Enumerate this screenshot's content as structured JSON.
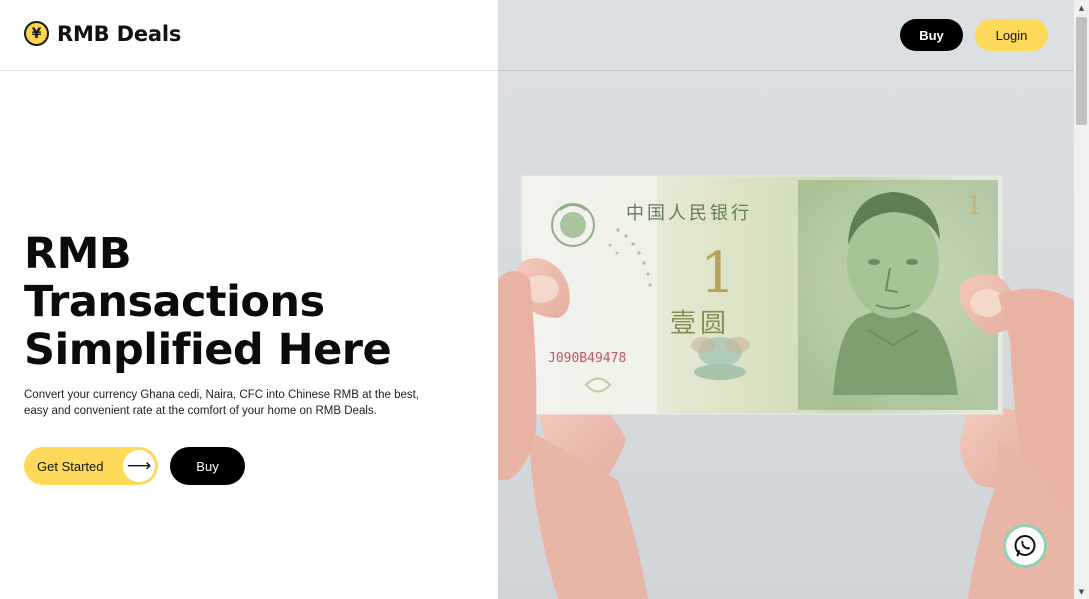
{
  "brand": {
    "logo_symbol": "¥",
    "name": "RMB Deals"
  },
  "nav": {
    "buy_label": "Buy",
    "login_label": "Login"
  },
  "hero": {
    "title_lines": [
      "RMB",
      "Transactions",
      "Simplified Here"
    ],
    "description": "Convert your currency Ghana cedi, Naira, CFC into Chinese RMB at the best, easy and convenient rate at the comfort of your home on RMB Deals.",
    "get_started_label": "Get Started",
    "get_started_arrow": "⟶",
    "buy_label": "Buy"
  },
  "banknote": {
    "issuer_text": "中国人民银行",
    "denomination": "1",
    "denomination_text": "壹圆",
    "serial": "J090B49478",
    "image_icon": "banknote-photo"
  },
  "floating": {
    "whatsapp_icon": "whatsapp-icon"
  },
  "colors": {
    "accent_yellow": "#ffd95a",
    "black": "#000000",
    "whatsapp_ring": "#8fd1b1",
    "note_green": "#a9c89a"
  }
}
